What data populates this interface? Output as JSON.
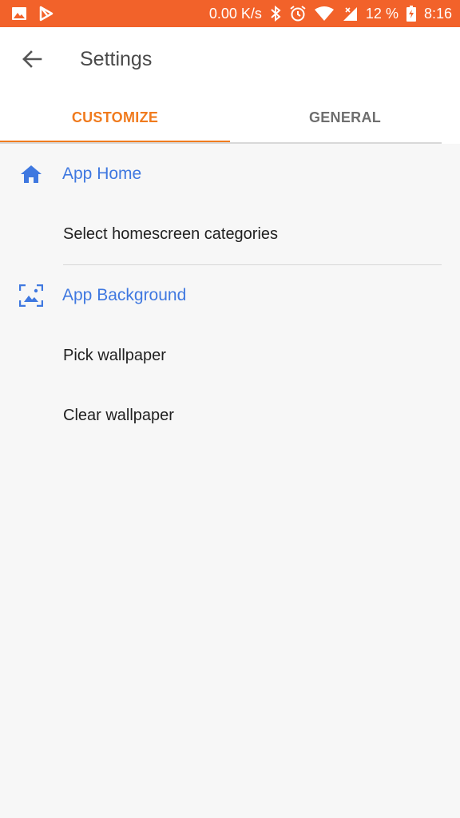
{
  "status_bar": {
    "net_speed": "0.00 K/s",
    "battery": "12 %",
    "time": "8:16",
    "icons": [
      "image-icon",
      "play-store-icon",
      "bluetooth-icon",
      "alarm-icon",
      "wifi-icon",
      "signal-icon",
      "battery-charging-icon"
    ],
    "color": "#f2622a"
  },
  "appbar": {
    "title": "Settings",
    "back_icon": "arrow-left-icon"
  },
  "tabs": [
    {
      "label": "CUSTOMIZE",
      "active": true
    },
    {
      "label": "GENERAL",
      "active": false
    }
  ],
  "accent_color": "#f07b1e",
  "section_color": "#3f78e0",
  "sections": [
    {
      "title": "App Home",
      "icon": "home-icon",
      "items": [
        {
          "label": "Select homescreen categories"
        }
      ]
    },
    {
      "title": "App Background",
      "icon": "wallpaper-icon",
      "items": [
        {
          "label": "Pick wallpaper"
        },
        {
          "label": "Clear wallpaper"
        }
      ]
    }
  ]
}
